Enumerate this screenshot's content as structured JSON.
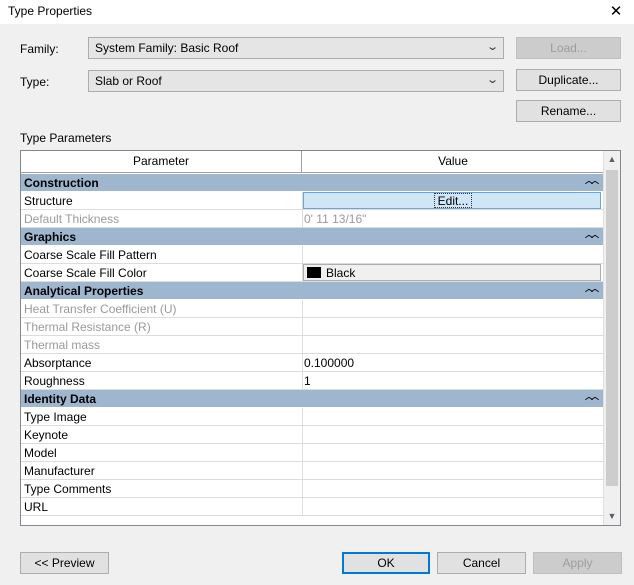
{
  "window": {
    "title": "Type Properties"
  },
  "family": {
    "label": "Family:",
    "value": "System Family: Basic Roof"
  },
  "type": {
    "label": "Type:",
    "value": "Slab or Roof"
  },
  "buttons": {
    "load": "Load...",
    "duplicate": "Duplicate...",
    "rename": "Rename...",
    "preview": "<< Preview",
    "ok": "OK",
    "cancel": "Cancel",
    "apply": "Apply"
  },
  "type_parameters": {
    "title": "Type Parameters",
    "columns": [
      "Parameter",
      "Value"
    ],
    "groups": [
      {
        "name": "Construction",
        "rows": [
          {
            "param": "Structure",
            "value": "Edit...",
            "kind": "edit"
          },
          {
            "param": "Default Thickness",
            "value": "0'  11 13/16\"",
            "dim": true
          }
        ]
      },
      {
        "name": "Graphics",
        "rows": [
          {
            "param": "Coarse Scale Fill Pattern",
            "value": ""
          },
          {
            "param": "Coarse Scale Fill Color",
            "value": "Black",
            "kind": "color"
          }
        ]
      },
      {
        "name": "Analytical Properties",
        "rows": [
          {
            "param": "Heat Transfer Coefficient (U)",
            "value": "",
            "dim": true
          },
          {
            "param": "Thermal Resistance (R)",
            "value": "",
            "dim": true
          },
          {
            "param": "Thermal mass",
            "value": "",
            "dim": true
          },
          {
            "param": "Absorptance",
            "value": "0.100000"
          },
          {
            "param": "Roughness",
            "value": "1"
          }
        ]
      },
      {
        "name": "Identity Data",
        "rows": [
          {
            "param": "Type Image",
            "value": ""
          },
          {
            "param": "Keynote",
            "value": ""
          },
          {
            "param": "Model",
            "value": ""
          },
          {
            "param": "Manufacturer",
            "value": ""
          },
          {
            "param": "Type Comments",
            "value": ""
          },
          {
            "param": "URL",
            "value": ""
          }
        ]
      }
    ]
  }
}
